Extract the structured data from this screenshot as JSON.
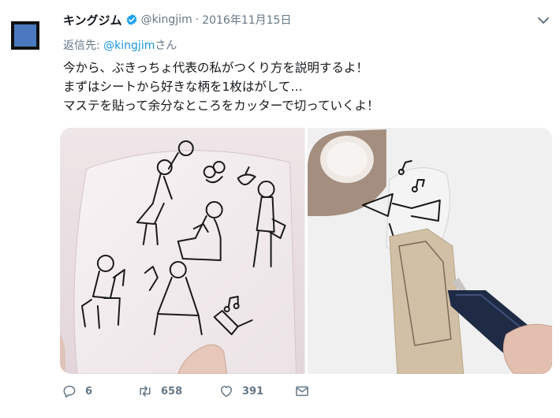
{
  "colors": {
    "accent": "#1b95e0",
    "muted": "#657786",
    "text": "#14171a",
    "avatar": "#4a79c0"
  },
  "user": {
    "display_name": "キングジム",
    "handle": "@kingjim",
    "separator": "·",
    "date": "2016年11月15日",
    "verified_icon": "verified-badge-icon"
  },
  "reply": {
    "label": "返信先: ",
    "mention": "@kingjim",
    "suffix": "さん"
  },
  "tweet": {
    "lines": [
      "今から、ぶきっちょ代表の私がつくり方を説明するよ！",
      "まずはシートから好きな柄を1枚はがして…",
      "マステを貼って余分なところをカッターで切っていくよ！"
    ]
  },
  "media": [
    {
      "icon": "photo-sticker-sheet"
    },
    {
      "icon": "photo-masking-tape-cutter"
    }
  ],
  "actions": {
    "reply_count": "6",
    "retweet_count": "658",
    "like_count": "391",
    "icons": [
      "reply-icon",
      "retweet-icon",
      "heart-icon",
      "direct-message-icon"
    ]
  }
}
